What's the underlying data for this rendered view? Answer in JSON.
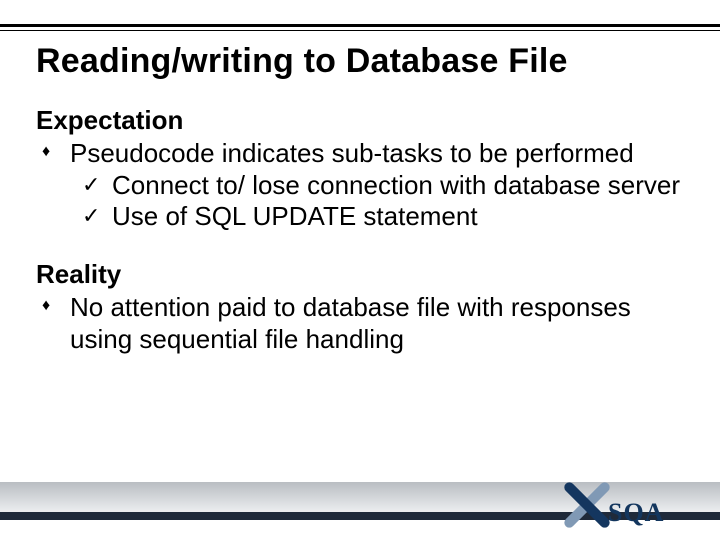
{
  "title": "Reading/writing to Database File",
  "sections": [
    {
      "heading": "Expectation",
      "items": [
        {
          "text": "Pseudocode indicates sub-tasks to be performed",
          "children": [
            {
              "text": "Connect to/ lose connection with database server"
            },
            {
              "text": "Use of SQL UPDATE statement"
            }
          ]
        }
      ]
    },
    {
      "heading": "Reality",
      "items": [
        {
          "text": "No attention paid to database file with responses using sequential file handling",
          "children": []
        }
      ]
    }
  ],
  "logo": {
    "text": "SQA",
    "brand_dark": "#13365e",
    "brand_light": "#8099b5"
  }
}
